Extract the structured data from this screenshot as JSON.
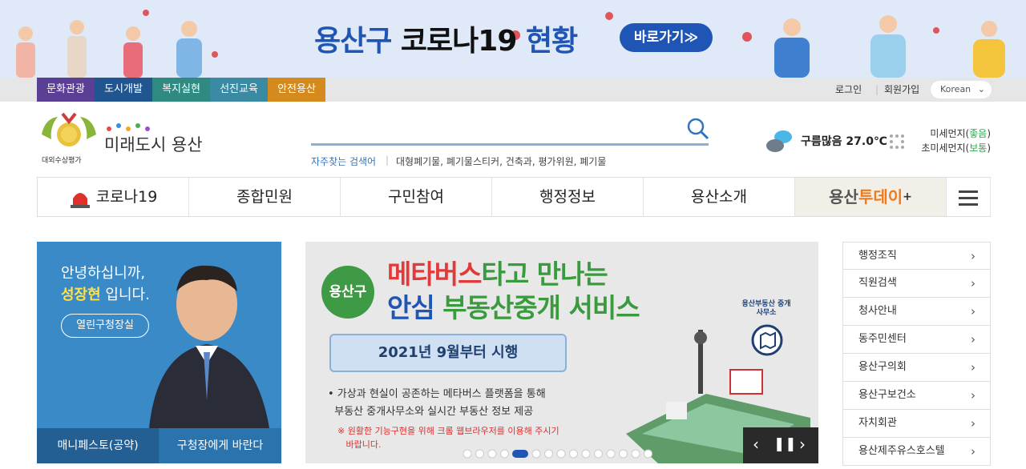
{
  "banner": {
    "title_part1": "용산구",
    "title_part2": "코로나19",
    "title_part3": "현황",
    "go_label": "바로가기≫"
  },
  "topbar": {
    "tabs": [
      {
        "label": "문화관광",
        "color": "#5a3f95"
      },
      {
        "label": "도시개발",
        "color": "#21558f"
      },
      {
        "label": "복지실현",
        "color": "#2f8a82"
      },
      {
        "label": "선진교육",
        "color": "#3a8aa3"
      },
      {
        "label": "안전용산",
        "color": "#d48a1c"
      }
    ],
    "login": "로그인",
    "signup": "회원가입",
    "language": "Korean"
  },
  "header": {
    "logo_text": "미래도시 용산",
    "award_text": "대외수상평가",
    "frequent_label": "자주찾는 검색어",
    "frequent_terms": "대형폐기물,  폐기물스티커,  건축과,  평가위원,  폐기물",
    "weather": "구름많음 27.0℃",
    "dust_label": "미세먼지",
    "dust_value": "좋음",
    "ultrafine_label": "초미세먼지",
    "ultrafine_value": "보통"
  },
  "nav": {
    "items": [
      "코로나19",
      "종합민원",
      "구민참여",
      "행정정보",
      "용산소개"
    ],
    "today_1": "용산",
    "today_2": "투데이"
  },
  "mayor": {
    "greeting": "안녕하십니까,",
    "name": "성장현",
    "name_suffix": " 입니다.",
    "open_office": "열린구청장실",
    "manifesto": "매니페스토(공약)",
    "wish": "구청장에게 바란다"
  },
  "slide": {
    "badge": "용산구",
    "headline_red": "메타버스",
    "headline_rest": "타고  만나는",
    "headline2_blue": "안심",
    "headline2_rest": " 부동산중개 서비스",
    "date_pill": "2021년 9월부터 시행",
    "desc1": "• 가상과 현실이 공존하는 메타버스 플랫폼을 통해",
    "desc2": "  부동산 중개사무소와 실시간 부동산 정보 제공",
    "note1": "※ 원활한 기능구현을 위해 크롬 웹브라우저를 이용해 주시기",
    "note2": "   바랍니다.",
    "office_label": "용산부동산 중개사무소",
    "total_slides": 15,
    "active_slide": 5
  },
  "side_links": [
    "행정조직",
    "직원검색",
    "청사안내",
    "동주민센터",
    "용산구의회",
    "용산구보건소",
    "자치회관",
    "용산제주유스호스텔"
  ]
}
